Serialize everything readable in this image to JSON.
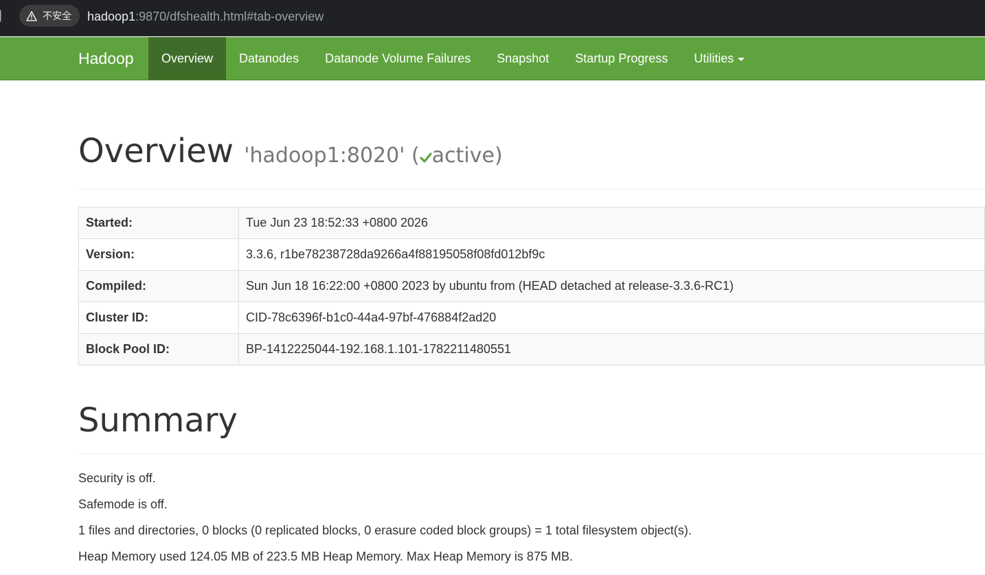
{
  "browser": {
    "security_label": "不安全",
    "security_icon": "warning-triangle-icon",
    "url_host": "hadoop1",
    "url_rest": ":9870/dfshealth.html#tab-overview"
  },
  "navbar": {
    "brand": "Hadoop",
    "color": "#5fa33e",
    "active_color": "#3f6d29",
    "items": [
      {
        "label": "Overview",
        "active": true
      },
      {
        "label": "Datanodes"
      },
      {
        "label": "Datanode Volume Failures"
      },
      {
        "label": "Snapshot"
      },
      {
        "label": "Startup Progress"
      },
      {
        "label": "Utilities",
        "dropdown": true
      }
    ]
  },
  "overview": {
    "title": "Overview",
    "namenode": "'hadoop1:8020'",
    "state_open": "(",
    "state": "active",
    "state_close": ")",
    "state_icon": "checkmark-icon",
    "rows": [
      {
        "label": "Started:",
        "value": "Tue Jun 23 18:52:33 +0800 2026"
      },
      {
        "label": "Version:",
        "value": "3.3.6, r1be78238728da9266a4f88195058f08fd012bf9c"
      },
      {
        "label": "Compiled:",
        "value": "Sun Jun 18 16:22:00 +0800 2023 by ubuntu from (HEAD detached at release-3.3.6-RC1)"
      },
      {
        "label": "Cluster ID:",
        "value": "CID-78c6396f-b1c0-44a4-97bf-476884f2ad20"
      },
      {
        "label": "Block Pool ID:",
        "value": "BP-1412225044-192.168.1.101-1782211480551"
      }
    ]
  },
  "summary": {
    "title": "Summary",
    "lines": [
      "Security is off.",
      "Safemode is off.",
      "1 files and directories, 0 blocks (0 replicated blocks, 0 erasure coded block groups) = 1 total filesystem object(s).",
      "Heap Memory used 124.05 MB of 223.5 MB Heap Memory. Max Heap Memory is 875 MB."
    ]
  }
}
